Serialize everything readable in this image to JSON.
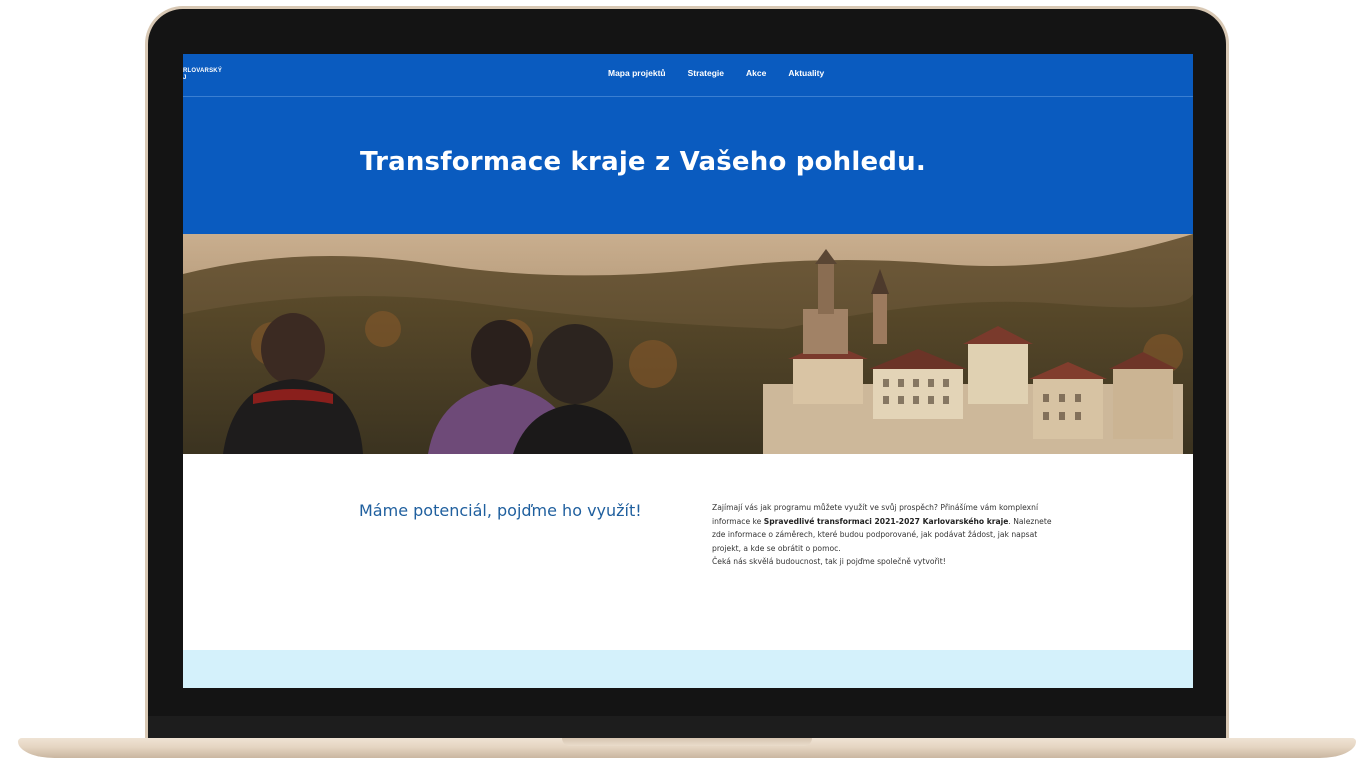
{
  "header": {
    "logo_line1": "RLOVARSKÝ",
    "logo_line2": "J",
    "nav": [
      "Mapa projektů",
      "Strategie",
      "Akce",
      "Aktuality"
    ]
  },
  "hero": {
    "title": "Transformace kraje z Vašeho pohledu."
  },
  "intro": {
    "heading": "Máme potenciál, pojďme ho využít!",
    "text_part1": "Zajímají vás jak programu můžete využít ve svůj prospěch? Přinášíme vám komplexní informace ke ",
    "text_bold": "Spravedlivé transformaci 2021-2027 Karlovarského kraje",
    "text_part2": ". Naleznete zde informace o záměrech, které budou podporované, jak podávat žádost, jak napsat projekt, a kde se obrátit o pomoc.",
    "text_line2": "Čeká nás skvělá budoucnost, tak ji pojďme společně vytvořit!"
  },
  "colors": {
    "brand_blue": "#0a5bbf",
    "heading_blue": "#1f5f9e",
    "footer_light_blue": "#d4f1fb",
    "laptop_gold": "#e5d5c2"
  }
}
